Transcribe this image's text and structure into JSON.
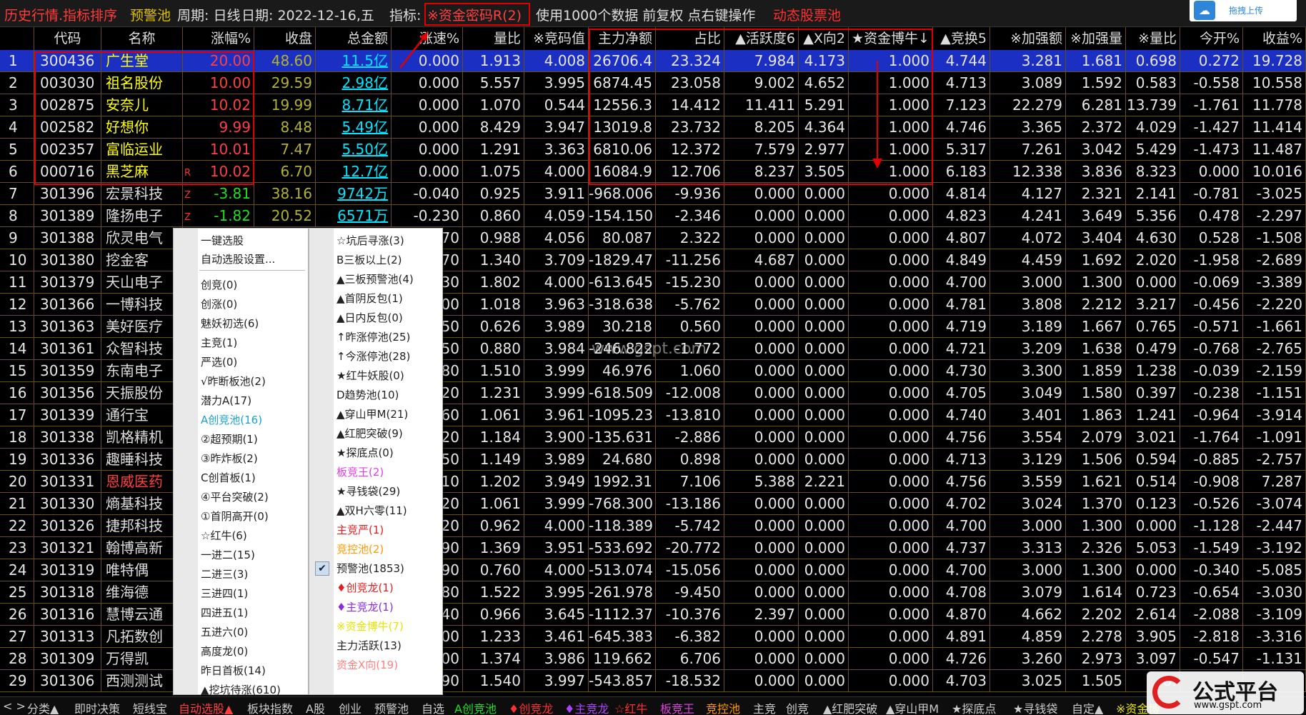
{
  "topbar": {
    "title": "历史行情.指标排序",
    "pool": "预警池",
    "period": "周期: 日线",
    "date": "日期: 2022-12-16,五",
    "indicator_label": "指标:",
    "indicator": "※资金密码R(2)",
    "info": "使用1000个数据 前复权 点右键操作",
    "dynamic": "动态股票池",
    "upload": "拖拽上传"
  },
  "colors": {
    "up": "#ff4040",
    "down": "#22dd22",
    "name_up": "#ffff00",
    "name_normal": "#dddddd",
    "selected_bg": "#1c2fc3",
    "redbox": "#e00000"
  },
  "headers": [
    "",
    "代码",
    "名称",
    "涨幅%",
    "收盘",
    "总金额",
    "涨速%",
    "量比",
    "※竞码值",
    "主力净额",
    "占比",
    "▲活跃度6",
    "▲X向2",
    "★资金博牛↓",
    "▲竞换5",
    "※加强额",
    "※加强量",
    "※量比",
    "今开%",
    "收益%"
  ],
  "rows": [
    {
      "i": "1",
      "code": "300436",
      "name": "广生堂",
      "flag": "",
      "chg": "20.00",
      "close": "48.60",
      "amt": "11.5亿",
      "v": [
        "0.000",
        "1.913",
        "4.008",
        "26706.4",
        "23.324",
        "7.984",
        "4.173",
        "1.000",
        "4.744",
        "3.281",
        "1.681",
        "0.698",
        "0.272",
        "19.728"
      ],
      "sel": true
    },
    {
      "i": "2",
      "code": "003030",
      "name": "祖名股份",
      "flag": "",
      "chg": "10.00",
      "close": "29.59",
      "amt": "2.98亿",
      "v": [
        "0.000",
        "5.557",
        "3.995",
        "6874.45",
        "23.058",
        "9.002",
        "4.652",
        "1.000",
        "4.713",
        "3.089",
        "1.592",
        "0.583",
        "-0.558",
        "10.558"
      ]
    },
    {
      "i": "3",
      "code": "002875",
      "name": "安奈儿",
      "flag": "",
      "chg": "10.02",
      "close": "19.99",
      "amt": "8.71亿",
      "v": [
        "0.000",
        "1.070",
        "0.544",
        "12556.3",
        "14.412",
        "11.411",
        "5.291",
        "1.000",
        "7.123",
        "22.279",
        "6.281",
        "13.739",
        "-1.761",
        "11.778"
      ]
    },
    {
      "i": "4",
      "code": "002582",
      "name": "好想你",
      "flag": "",
      "chg": "9.99",
      "close": "8.48",
      "amt": "5.49亿",
      "v": [
        "0.000",
        "8.429",
        "3.947",
        "13019.8",
        "23.732",
        "8.205",
        "4.364",
        "1.000",
        "4.746",
        "3.365",
        "2.372",
        "4.029",
        "-1.427",
        "11.414"
      ]
    },
    {
      "i": "5",
      "code": "002357",
      "name": "富临运业",
      "flag": "",
      "chg": "10.01",
      "close": "7.47",
      "amt": "5.50亿",
      "v": [
        "0.000",
        "1.291",
        "3.363",
        "6810.06",
        "12.372",
        "7.579",
        "2.977",
        "1.000",
        "5.317",
        "7.261",
        "3.042",
        "5.429",
        "-1.473",
        "11.487"
      ]
    },
    {
      "i": "6",
      "code": "000716",
      "name": "黑芝麻",
      "flag": "R",
      "chg": "10.02",
      "close": "6.70",
      "amt": "12.7亿",
      "v": [
        "0.000",
        "1.075",
        "4.000",
        "16084.9",
        "12.706",
        "8.237",
        "3.505",
        "1.000",
        "6.183",
        "12.338",
        "3.836",
        "8.323",
        "0.000",
        "10.016"
      ]
    },
    {
      "i": "7",
      "code": "301396",
      "name": "宏景科技",
      "flag": "Z",
      "chg": "-3.81",
      "close": "38.16",
      "amt": "9742万",
      "v": [
        "-0.040",
        "0.925",
        "3.911",
        "-968.006",
        "-9.936",
        "0.000",
        "0.000",
        "0.000",
        "4.814",
        "4.127",
        "2.321",
        "2.141",
        "-0.781",
        "-3.025"
      ]
    },
    {
      "i": "8",
      "code": "301389",
      "name": "隆扬电子",
      "flag": "Z",
      "chg": "-1.82",
      "close": "20.52",
      "amt": "6571万",
      "v": [
        "-0.230",
        "0.860",
        "4.059",
        "-154.150",
        "-2.346",
        "0.000",
        "0.000",
        "0.000",
        "4.823",
        "4.241",
        "3.649",
        "5.356",
        "0.478",
        "-2.297"
      ]
    },
    {
      "i": "9",
      "code": "301388",
      "name": "欣灵电气",
      "v": [
        "70",
        "0.988",
        "4.056",
        "80.087",
        "2.322",
        "0.000",
        "0.000",
        "0.000",
        "4.807",
        "4.072",
        "3.404",
        "4.630",
        "0.528",
        "-1.508"
      ]
    },
    {
      "i": "10",
      "code": "301380",
      "name": "挖金客",
      "v": [
        "70",
        "1.340",
        "3.709",
        "-1829.47",
        "-11.256",
        "4.687",
        "0.000",
        "0.000",
        "4.849",
        "4.459",
        "1.692",
        "2.020",
        "-1.958",
        "-2.689"
      ]
    },
    {
      "i": "11",
      "code": "301379",
      "name": "天山电子",
      "v": [
        "30",
        "1.802",
        "4.000",
        "-613.645",
        "-15.230",
        "0.000",
        "0.000",
        "0.000",
        "4.700",
        "3.000",
        "1.300",
        "0.000",
        "-0.069",
        "-3.389"
      ]
    },
    {
      "i": "12",
      "code": "301366",
      "name": "一博科技",
      "v": [
        "00",
        "1.018",
        "3.963",
        "-318.638",
        "-5.762",
        "0.000",
        "0.000",
        "0.000",
        "4.781",
        "3.808",
        "2.212",
        "3.217",
        "-0.456",
        "-2.220"
      ]
    },
    {
      "i": "13",
      "code": "301363",
      "name": "美好医疗",
      "v": [
        "50",
        "0.626",
        "3.989",
        "30.218",
        "0.560",
        "0.000",
        "0.000",
        "0.000",
        "4.719",
        "3.189",
        "1.667",
        "0.765",
        "-0.571",
        "-1.661"
      ]
    },
    {
      "i": "14",
      "code": "301361",
      "name": "众智科技",
      "v": [
        "50",
        "0.880",
        "3.984",
        "-246.822",
        "-1.772",
        "0.000",
        "0.000",
        "0.000",
        "4.721",
        "3.209",
        "1.638",
        "0.479",
        "-0.768",
        "-2.765"
      ]
    },
    {
      "i": "15",
      "code": "301359",
      "name": "东南电子",
      "v": [
        "80",
        "1.510",
        "3.999",
        "46.976",
        "1.060",
        "0.000",
        "0.000",
        "0.000",
        "4.730",
        "3.300",
        "1.859",
        "1.238",
        "-0.039",
        "-2.159"
      ]
    },
    {
      "i": "16",
      "code": "301356",
      "name": "天振股份",
      "v": [
        "20",
        "1.231",
        "3.999",
        "-618.509",
        "-12.008",
        "0.000",
        "0.000",
        "0.000",
        "4.705",
        "3.049",
        "1.580",
        "0.397",
        "-0.238",
        "-1.151"
      ]
    },
    {
      "i": "17",
      "code": "301339",
      "name": "通行宝",
      "v": [
        "60",
        "1.061",
        "3.961",
        "-1095.23",
        "-13.810",
        "0.000",
        "0.000",
        "0.000",
        "4.740",
        "3.401",
        "1.863",
        "1.241",
        "-0.964",
        "-3.914"
      ]
    },
    {
      "i": "18",
      "code": "301338",
      "name": "凯格精机",
      "v": [
        "20",
        "1.184",
        "3.900",
        "-135.631",
        "-2.886",
        "0.000",
        "0.000",
        "0.000",
        "4.756",
        "3.554",
        "2.079",
        "3.021",
        "-1.764",
        "-1.091"
      ]
    },
    {
      "i": "19",
      "code": "301336",
      "name": "趣睡科技",
      "v": [
        "50",
        "1.149",
        "3.989",
        "24.680",
        "0.898",
        "0.000",
        "0.000",
        "0.000",
        "4.713",
        "3.129",
        "1.506",
        "0.594",
        "-0.885",
        "-2.757"
      ]
    },
    {
      "i": "20",
      "code": "301331",
      "name": "恩威医药",
      "nameColor": "#ff4040",
      "v": [
        "10",
        "1.202",
        "3.949",
        "1992.31",
        "7.106",
        "5.388",
        "2.221",
        "0.000",
        "4.756",
        "3.559",
        "1.621",
        "0.514",
        "-0.908",
        "7.287"
      ]
    },
    {
      "i": "21",
      "code": "301330",
      "name": "熵基科技",
      "v": [
        "20",
        "1.061",
        "3.999",
        "-768.300",
        "-13.186",
        "0.000",
        "0.000",
        "0.000",
        "4.702",
        "3.024",
        "1.370",
        "0.123",
        "-0.526",
        "-3.074"
      ]
    },
    {
      "i": "22",
      "code": "301326",
      "name": "捷邦科技",
      "v": [
        "20",
        "0.962",
        "4.000",
        "-118.389",
        "-5.742",
        "0.000",
        "0.000",
        "0.000",
        "4.700",
        "3.000",
        "1.300",
        "0.000",
        "-1.128",
        "-2.447"
      ]
    },
    {
      "i": "23",
      "code": "301321",
      "name": "翰博高新",
      "v": [
        "90",
        "1.369",
        "3.951",
        "-533.692",
        "-20.772",
        "0.000",
        "0.000",
        "0.000",
        "4.737",
        "3.313",
        "2.326",
        "5.053",
        "-1.549",
        "-3.192"
      ]
    },
    {
      "i": "24",
      "code": "301319",
      "name": "唯特偶",
      "v": [
        "90",
        "0.760",
        "4.000",
        "-513.074",
        "-15.056",
        "0.000",
        "0.000",
        "0.000",
        "4.700",
        "3.000",
        "1.300",
        "0.000",
        "-0.340",
        "-5.085"
      ]
    },
    {
      "i": "25",
      "code": "301318",
      "name": "维海德",
      "v": [
        "80",
        "1.522",
        "3.995",
        "-261.978",
        "-9.450",
        "0.000",
        "0.000",
        "0.000",
        "4.708",
        "3.079",
        "1.614",
        "0.723",
        "-0.654",
        "-3.030"
      ]
    },
    {
      "i": "26",
      "code": "301316",
      "name": "慧博云通",
      "v": [
        "40",
        "0.966",
        "3.645",
        "-1112.37",
        "-10.376",
        "2.397",
        "0.000",
        "0.000",
        "4.870",
        "4.662",
        "2.202",
        "2.614",
        "-2.088",
        "-3.109"
      ]
    },
    {
      "i": "27",
      "code": "301313",
      "name": "凡拓数创",
      "v": [
        "00",
        "1.233",
        "3.461",
        "-645.383",
        "-6.382",
        "0.000",
        "0.000",
        "0.000",
        "4.891",
        "4.859",
        "2.278",
        "3.905",
        "-2.818",
        "-3.316"
      ]
    },
    {
      "i": "28",
      "code": "301309",
      "name": "万得凯",
      "v": [
        "00",
        "1.374",
        "3.986",
        "119.662",
        "6.706",
        "0.000",
        "0.000",
        "0.000",
        "4.726",
        "3.260",
        "2.973",
        "3.097",
        "-0.547",
        "-1.131"
      ]
    },
    {
      "i": "29",
      "code": "301306",
      "name": "西测测试",
      "v": [
        "90",
        "1.540",
        "3.997",
        "-543.857",
        "-18.532",
        "0.000",
        "0.000",
        "0.000",
        "4.703",
        "3.025",
        "1.505",
        "0.",
        "",
        ""
      ]
    }
  ],
  "menu_left": [
    "一键选股",
    "自动选股设置...",
    "创竞(0)",
    "创涨(0)",
    "魅妖初选(6)",
    "主竞(1)",
    "严选(0)",
    "√昨断板池(2)",
    "潜力A(17)",
    "A创竞池(16)",
    "②超预期(1)",
    "③昨炸板(2)",
    "C创首板(1)",
    "④平台突破(2)",
    "①首阴高开(0)",
    "☆红牛(6)",
    "一进二(15)",
    "二进三(3)",
    "三进四(1)",
    "四进五(1)",
    "五进六(0)",
    "高度龙(0)",
    "昨日首板(14)",
    "▲挖坑待涨(610)"
  ],
  "menu_right": [
    {
      "t": "☆坑后寻涨(3)",
      "c": "#222"
    },
    {
      "t": "B三板以上(2)",
      "c": "#222"
    },
    {
      "t": "▲三板预警池(4)",
      "c": "#222"
    },
    {
      "t": "▲首阴反包(1)",
      "c": "#222"
    },
    {
      "t": "▲日内反包(0)",
      "c": "#222"
    },
    {
      "t": "↑昨涨停池(25)",
      "c": "#222"
    },
    {
      "t": "↑今涨停池(28)",
      "c": "#222"
    },
    {
      "t": "★红牛妖股(0)",
      "c": "#222"
    },
    {
      "t": "D趋势池(10)",
      "c": "#222"
    },
    {
      "t": "▲穿山甲M(21)",
      "c": "#222"
    },
    {
      "t": "▲红肥突破(9)",
      "c": "#222"
    },
    {
      "t": "★探底点(0)",
      "c": "#222"
    },
    {
      "t": "板竞王(2)",
      "c": "#e040e0"
    },
    {
      "t": "★寻钱袋(29)",
      "c": "#222"
    },
    {
      "t": "▲双H六零(11)",
      "c": "#222"
    },
    {
      "t": "主竞严(1)",
      "c": "#e02020"
    },
    {
      "t": "竞控池(2)",
      "c": "#ff9900"
    },
    {
      "t": "预警池(1853)",
      "c": "#222"
    },
    {
      "t": "♦创竞龙(1)",
      "c": "#e02020"
    },
    {
      "t": "♦主竞龙(1)",
      "c": "#8a2be2"
    },
    {
      "t": "※资金博牛(7)",
      "c": "#e6e600"
    },
    {
      "t": "主力活跃(13)",
      "c": "#222"
    },
    {
      "t": "资金X向(19)",
      "c": "#ff8080"
    }
  ],
  "bottom": [
    "分类▲",
    "即时决策",
    "短线宝",
    "自动选股▲",
    "板块指数",
    "A股",
    "创业",
    "预警池",
    "自选",
    "A创竞池",
    "♦创竞龙",
    "♦主竞龙",
    "☆红牛",
    "板竞王",
    "竞控池",
    "主竞",
    "创竞",
    "▲红肥突破",
    "▲穿山甲M",
    "★探底点",
    "★寻钱袋",
    "自定▲",
    "※资金博"
  ],
  "bottom_colors": [
    "#ccc",
    "#ccc",
    "#ccc",
    "#ff4040",
    "#ccc",
    "#ccc",
    "#ccc",
    "#ccc",
    "#ccc",
    "#22dd22",
    "#ff3030",
    "#b040ff",
    "#ff3030",
    "#e040e0",
    "#ff9900",
    "#ccc",
    "#ccc",
    "#ccc",
    "#ccc",
    "#ccc",
    "#ccc",
    "#ccc",
    "#e6e600"
  ],
  "watermark": {
    "brand": "公式平台",
    "url": "www.gspt.com",
    "center": "www.gspt.com"
  }
}
